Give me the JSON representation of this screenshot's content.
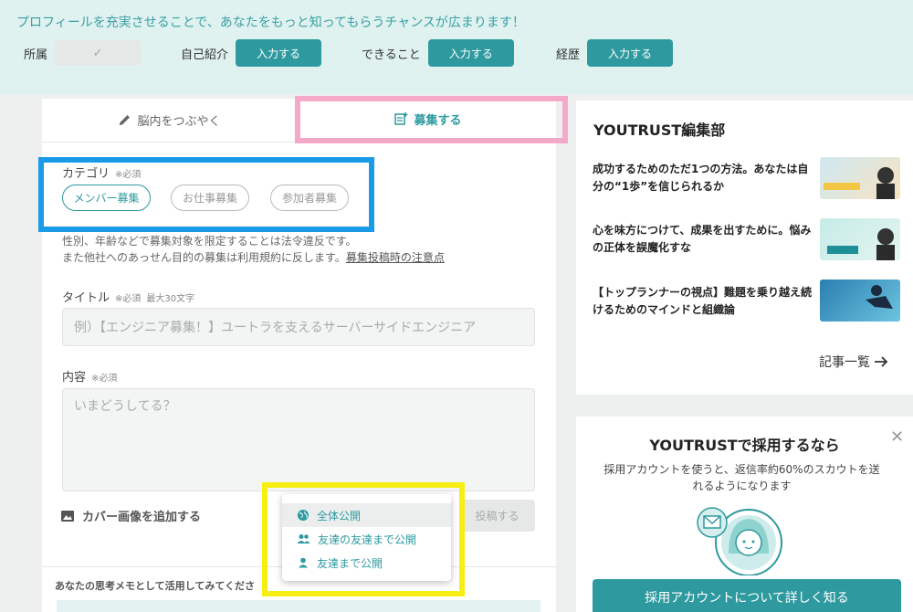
{
  "banner": {
    "message": "プロフィールを充実させることで、あなたをもっと知ってもらうチャンスが広まります！",
    "items": [
      {
        "label": "所属",
        "button": "✓"
      },
      {
        "label": "自己紹介",
        "button": "入力する"
      },
      {
        "label": "できること",
        "button": "入力する"
      },
      {
        "label": "経歴",
        "button": "入力する"
      }
    ]
  },
  "tabs": {
    "tweet": "脳内をつぶやく",
    "recruit": "募集する"
  },
  "form": {
    "category_label": "カテゴリ",
    "required": "※必須",
    "categories": [
      "メンバー募集",
      "お仕事募集",
      "参加者募集"
    ],
    "notice_line1": "性別、年齢などで募集対象を限定することは法令違反です。",
    "notice_line2": "また他社へのあっせん目的の募集は利用規約に反します。",
    "notice_link": "募集投稿時の注意点",
    "title_label": "タイトル",
    "title_limit": "最大30文字",
    "title_placeholder": "例）【エンジニア募集！】ユートラを支えるサーバーサイドエンジニア",
    "content_label": "内容",
    "content_placeholder": "いまどうしてる？",
    "cover_label": "カバー画像を追加する",
    "post_button": "投稿する",
    "memo_text": "あなたの思考メモとして活用してみてくださ"
  },
  "visibility_menu": {
    "options": [
      "全体公開",
      "友達の友達まで公開",
      "友達まで公開"
    ],
    "selected": "全体公開"
  },
  "editorial": {
    "title": "YOUTRUST編集部",
    "articles": [
      {
        "title": "成功するためのただ1つの方法。あなたは自分の“1歩”を信じられるか"
      },
      {
        "title": "心を味方につけて、成果を出すために。悩みの正体を誤魔化すな"
      },
      {
        "title": "【トップランナーの視点】難題を乗り越え続けるためのマインドと組織論"
      }
    ],
    "more": "記事一覧"
  },
  "hire": {
    "title": "YOUTRUSTで採用するなら",
    "desc_line1": "採用アカウントを使うと、返信率約60%のスカウトを送",
    "desc_line2": "れるようになります",
    "button": "採用アカウントについて詳しく知る"
  },
  "colors": {
    "accent": "#2e9a9f",
    "banner_bg": "#dff2f0",
    "highlight_pink": "#f5a9c8",
    "highlight_blue": "#1a9be8",
    "highlight_yellow": "#f7ef14"
  }
}
